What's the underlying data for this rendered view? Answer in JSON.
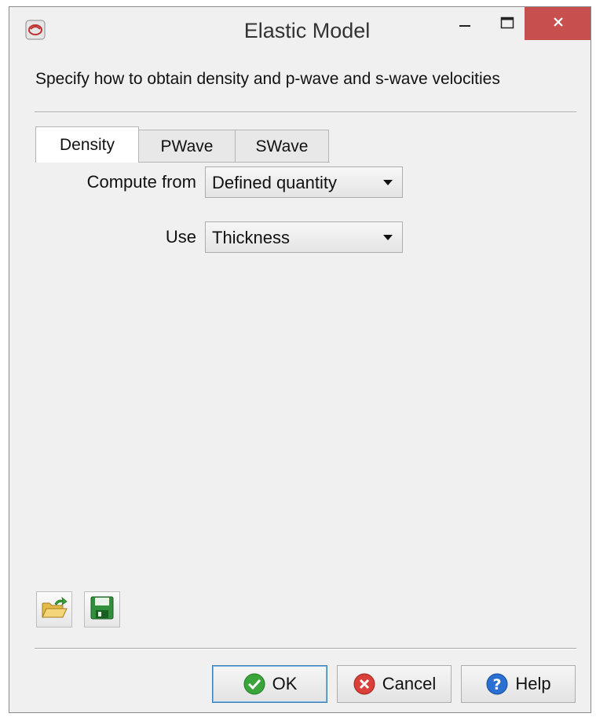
{
  "window": {
    "title": "Elastic Model",
    "app_icon": "app-logo-icon",
    "controls": {
      "minimize": "minimize-icon",
      "maximize": "maximize-icon",
      "close": "close-icon"
    }
  },
  "instructions": "Specify how to obtain density and p-wave and s-wave velocities",
  "tabs": [
    {
      "label": "Density",
      "active": true
    },
    {
      "label": "PWave",
      "active": false
    },
    {
      "label": "SWave",
      "active": false
    }
  ],
  "density": {
    "compute_from": {
      "label": "Compute from",
      "value": "Defined quantity"
    },
    "use": {
      "label": "Use",
      "value": "Thickness"
    }
  },
  "tools": {
    "open_icon": "open-folder-icon",
    "save_icon": "save-disk-icon"
  },
  "buttons": {
    "ok": "OK",
    "cancel": "Cancel",
    "help": "Help"
  },
  "colors": {
    "close_button": "#c7504f",
    "ok_icon": "#3aa53a",
    "cancel_icon": "#d9403a",
    "help_icon": "#2a6fd1"
  }
}
